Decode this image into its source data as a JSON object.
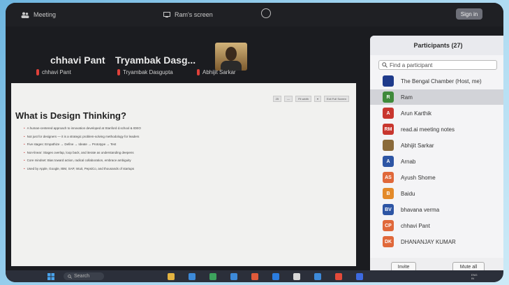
{
  "window": {
    "app_label": "Meeting",
    "share_label": "Ram's screen",
    "sign_in_label": "Sign in"
  },
  "tiles": [
    {
      "name": "chhavi Pant",
      "sub": "chhavi Pant"
    },
    {
      "name": "Tryambak  Dasg...",
      "sub": "Tryambak Dasgupta"
    },
    {
      "sub": "Abhijit Sarkar"
    }
  ],
  "slide": {
    "toolbar": [
      "25",
      "—",
      "Fit width",
      "▾",
      "Exit Full Screen"
    ],
    "title": "What is Design Thinking?",
    "bullets": [
      "A human-centered approach to innovation developed at Stanford d.school & IDEO",
      "Not just for designers — it is a strategic problem-solving methodology for leaders",
      "Five stages: Empathize → Define → Ideate → Prototype → Test",
      "Non-linear: Stages overlap, loop back, and iterate as understanding deepens",
      "Core mindset: Bias toward action, radical collaboration, embrace ambiguity",
      "Used by Apple, Google, IBM, SAP, Intuit, PepsiCo, and thousands of startups"
    ]
  },
  "participants": {
    "header": "Participants (27)",
    "search_placeholder": "Find a participant",
    "list": [
      {
        "initials": "",
        "name": "The Bengal Chamber (Host, me)",
        "color": "#1e3a8a",
        "selected": false
      },
      {
        "initials": "R",
        "name": "Ram",
        "color": "#3f8a3a",
        "selected": true
      },
      {
        "initials": "A",
        "name": "Arun Karthik",
        "color": "#c8362e",
        "selected": false
      },
      {
        "initials": "RM",
        "name": "read.ai meeting notes",
        "color": "#c8362e",
        "selected": false
      },
      {
        "initials": "",
        "name": "Abhijit Sarkar",
        "color": "#8a6a3a",
        "selected": false
      },
      {
        "initials": "A",
        "name": "Arnab",
        "color": "#2d55a4",
        "selected": false
      },
      {
        "initials": "AS",
        "name": "Ayush Shome",
        "color": "#e0683a",
        "selected": false
      },
      {
        "initials": "B",
        "name": "Baidu",
        "color": "#e38a2a",
        "selected": false
      },
      {
        "initials": "BV",
        "name": "bhavana verma",
        "color": "#2d55a4",
        "selected": false
      },
      {
        "initials": "CP",
        "name": "chhavi Pant",
        "color": "#e0683a",
        "selected": false
      },
      {
        "initials": "DK",
        "name": "DHANANJAY KUMAR",
        "color": "#e0683a",
        "selected": false
      }
    ],
    "invite_label": "Invite",
    "mute_all_label": "Mute all"
  },
  "taskbar": {
    "search_label": "Search",
    "tray_lang": "ENG",
    "tray_region": "IN",
    "colors": [
      "#e3b341",
      "#3d8ad9",
      "#3da35d",
      "#3d8ad9",
      "#e05a3a",
      "#2b7de0",
      "#d8d8d8",
      "#3d8ad9",
      "#e34a3a",
      "#3d6ae0"
    ]
  }
}
